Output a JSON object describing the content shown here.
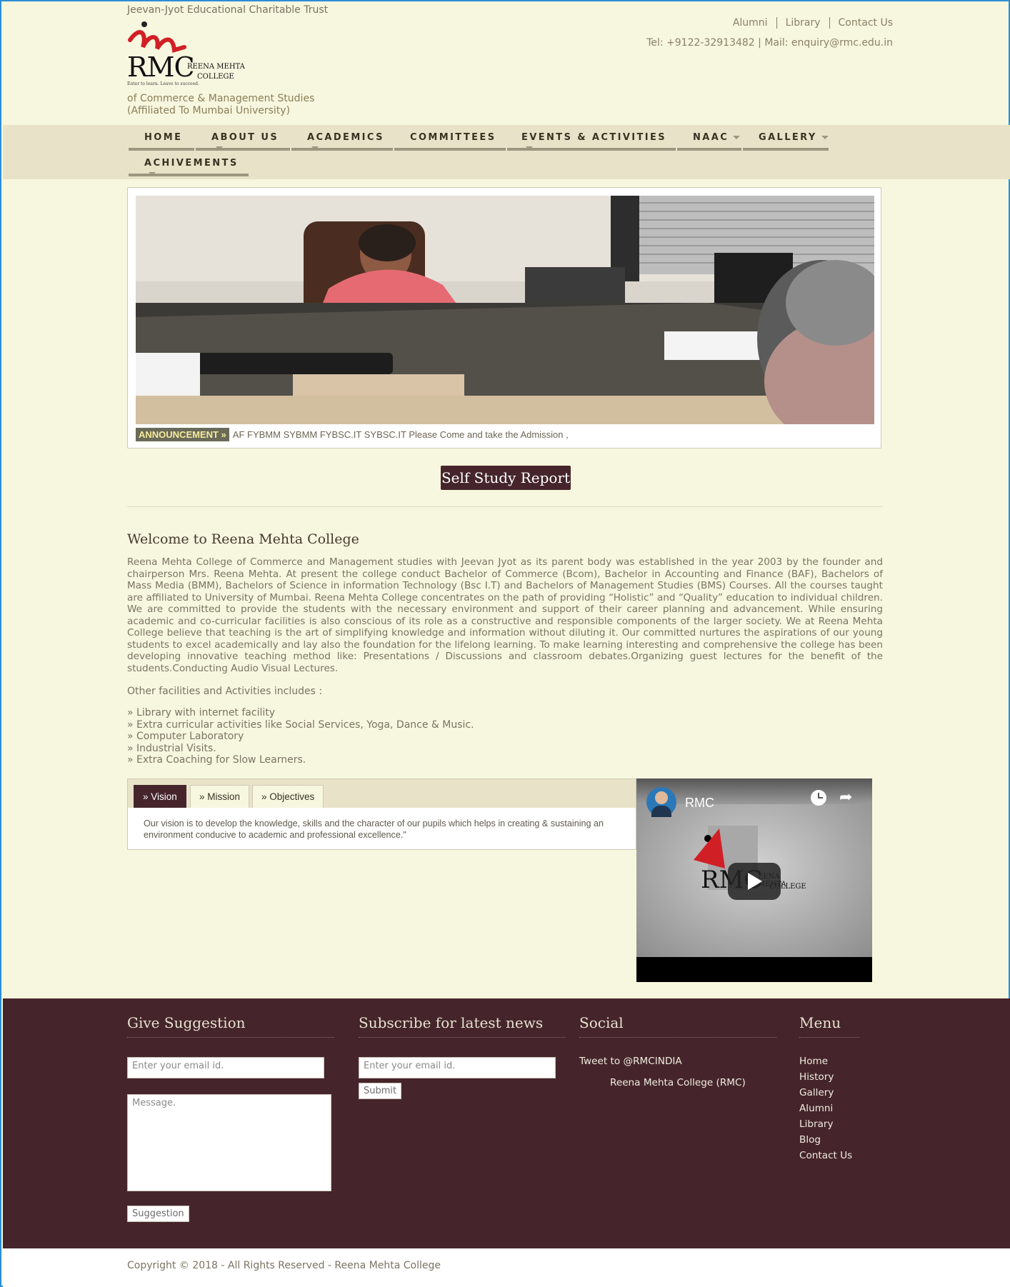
{
  "header": {
    "trust": "Jeevan-Jyot Educational Charitable Trust",
    "logo_text": "RMC",
    "logo_sub1": "REENA MEHTA",
    "logo_sub2": "COLLEGE",
    "logo_motto": "Enter to learn. Leave to succeed.",
    "tagline1": "of Commerce & Management Studies",
    "tagline2": "(Affiliated To Mumbai University)",
    "toplinks": [
      "Alumni",
      "Library",
      "Contact Us"
    ],
    "contact": "Tel: +9122-32913482 | Mail: enquiry@rmc.edu.in"
  },
  "nav": [
    {
      "label": "HOME"
    },
    {
      "label": "ABOUT US"
    },
    {
      "label": "ACADEMICS"
    },
    {
      "label": "COMMITTEES"
    },
    {
      "label": "EVENTS & ACTIVITIES"
    },
    {
      "label": "NAAC"
    },
    {
      "label": "GALLERY"
    },
    {
      "label": "ACHIVEMENTS"
    }
  ],
  "slider": {
    "announcement_label": "ANNOUNCEMENT »",
    "announcement_text": "AF FYBMM SYBMM FYBSC.IT SYBSC.IT Please Come and take the Admission ,"
  },
  "ssr_button": "Self Study Report",
  "welcome": {
    "title": "Welcome to Reena Mehta College",
    "text": "Reena Mehta College of Commerce and Management studies with Jeevan Jyot as its parent body was established in the year 2003 by the founder and chairperson Mrs. Reena Mehta. At present the college conduct Bachelor of Commerce (Bcom), Bachelor in Accounting and Finance (BAF), Bachelors of Mass Media (BMM), Bachelors of Science in information Technology (Bsc I.T) and Bachelors of Management Studies (BMS) Courses. All the courses taught are affiliated to University of Mumbai. Reena Mehta College concentrates on the path of providing “Holistic” and “Quality” education to individual children. We are committed to provide the students with the necessary environment and support of their career planning and advancement. While ensuring academic and co-curricular facilities is also conscious of its role as a constructive and responsible components of the larger society. We at Reena Mehta College believe that teaching is the art of simplifying knowledge and information without diluting it. Our committed nurtures the aspirations of our young students to excel academically and lay also the foundation for the lifelong learning. To make learning interesting and comprehensive the college has been developing innovative teaching method like: Presentations / Discussions and classroom debates.Organizing guest lectures for the benefit of the students.Conducting Audio Visual Lectures.",
    "facilities_heading": "Other facilities and Activities includes :",
    "facilities": [
      "» Library with internet facility",
      "» Extra curricular activities like Social Services, Yoga, Dance & Music.",
      "» Computer Laboratory",
      "» Industrial Visits.",
      "» Extra Coaching for Slow Learners."
    ]
  },
  "tabs": {
    "items": [
      "» Vision",
      "» Mission",
      "» Objectives"
    ],
    "active": 0,
    "content": "Our vision is to develop the knowledge, skills and the character of our pupils which helps in creating & sustaining an environment conducive to academic and professional excellence.\""
  },
  "video": {
    "channel": "RMC",
    "logo_text": "RMC",
    "logo_sub1": "EENA MEHTA",
    "logo_sub2": "COLLEGE"
  },
  "footer": {
    "suggestion": {
      "heading": "Give Suggestion",
      "email_placeholder": "Enter your email id.",
      "message_placeholder": "Message.",
      "button": "Suggestion"
    },
    "subscribe": {
      "heading": "Subscribe for latest news",
      "email_placeholder": "Enter your email id.",
      "button": "Submit"
    },
    "social": {
      "heading": "Social",
      "tweet": "Tweet to @RMCINDIA",
      "page": "Reena Mehta College (RMC)"
    },
    "menu": {
      "heading": "Menu",
      "items": [
        "Home",
        "History",
        "Gallery",
        "Alumni",
        "Library",
        "Blog",
        "Contact Us"
      ]
    },
    "copyright": "Copyright © 2018 - All Rights Reserved - Reena Mehta College"
  }
}
